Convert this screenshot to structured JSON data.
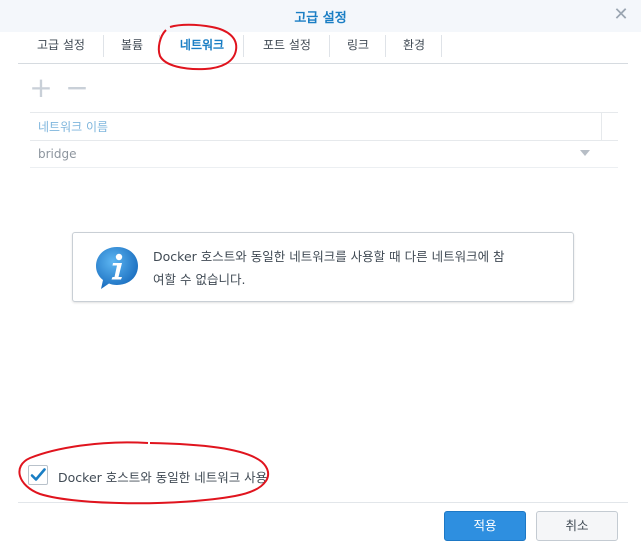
{
  "dialog": {
    "title": "고급 설정"
  },
  "tabs": [
    {
      "label": "고급 설정"
    },
    {
      "label": "볼륨"
    },
    {
      "label": "네트워크"
    },
    {
      "label": "포트 설정"
    },
    {
      "label": "링크"
    },
    {
      "label": "환경"
    }
  ],
  "active_tab_index": 2,
  "toolbar": {
    "add_icon": "plus-icon",
    "remove_icon": "minus-icon"
  },
  "grid": {
    "columns": [
      "네트워크 이름"
    ],
    "rows": [
      {
        "name": "bridge"
      }
    ]
  },
  "info_box": {
    "icon": "info-icon",
    "text_line1": "Docker 호스트와 동일한 네트워크를 사용할 때 다른 네트워크에 참",
    "text_line2": "여할 수 없습니다."
  },
  "host_network_option": {
    "label": "Docker 호스트와 동일한 네트워크 사용",
    "checked": true
  },
  "footer": {
    "apply_label": "적용",
    "cancel_label": "취소"
  },
  "colors": {
    "accent": "#1a7ec4",
    "primary_button": "#2e8fe0",
    "annotation": "#e0141e"
  }
}
